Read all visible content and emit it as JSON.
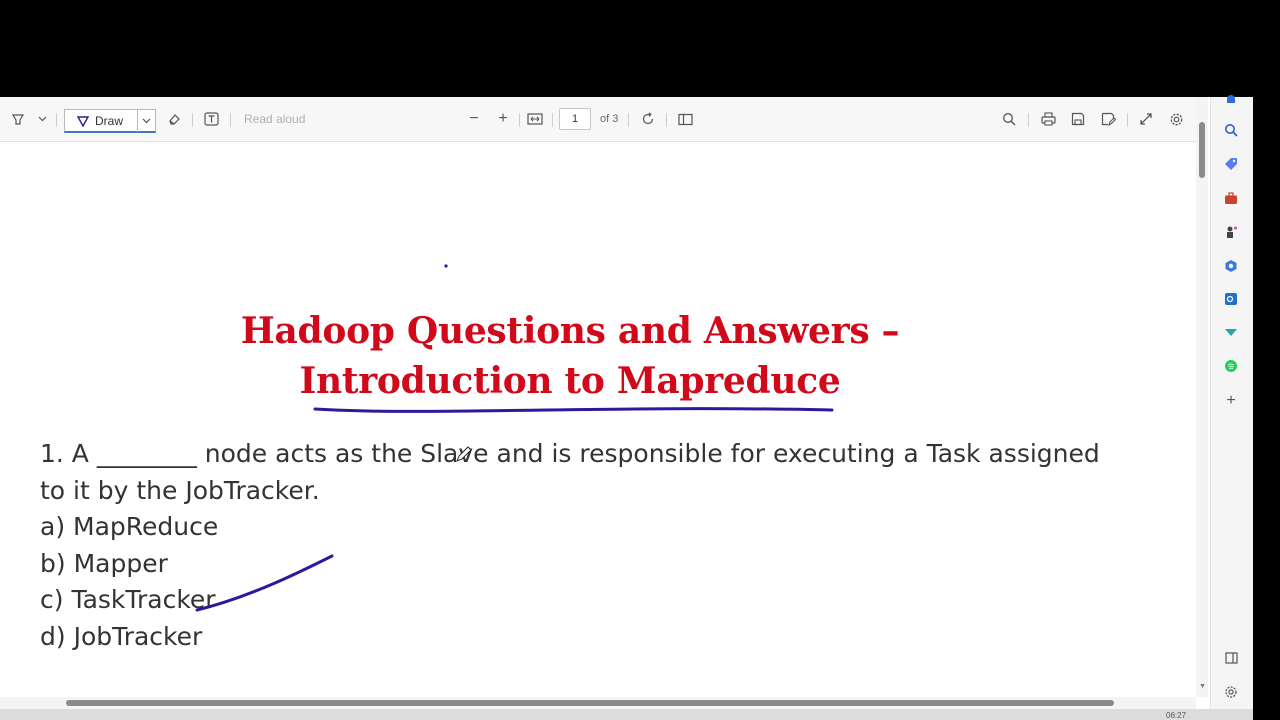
{
  "toolbar": {
    "draw_label": "Draw",
    "read_aloud_label": "Read aloud",
    "page_number": "1",
    "page_of": "of 3"
  },
  "document": {
    "title_line1": "Hadoop Questions and Answers –",
    "title_line2": "Introduction to Mapreduce",
    "question_line1": "1. A ________ node acts as the Slave and is responsible for executing a Task assigned",
    "question_line2": "to it by the JobTracker.",
    "options": [
      "a) MapReduce",
      "b) Mapper",
      "c) TaskTracker",
      "d) JobTracker"
    ]
  },
  "ink_color": "#2a1a9c",
  "title_color": "#d10a1b",
  "sidebar_icons": [
    "bell-icon",
    "search-icon",
    "tag-icon",
    "briefcase-icon",
    "chess-icon",
    "copilot-icon",
    "outlook-icon",
    "drop-icon",
    "spotify-icon",
    "plus-icon",
    "split-view-icon",
    "settings-icon"
  ],
  "taskbar": {
    "time": "06:27"
  }
}
